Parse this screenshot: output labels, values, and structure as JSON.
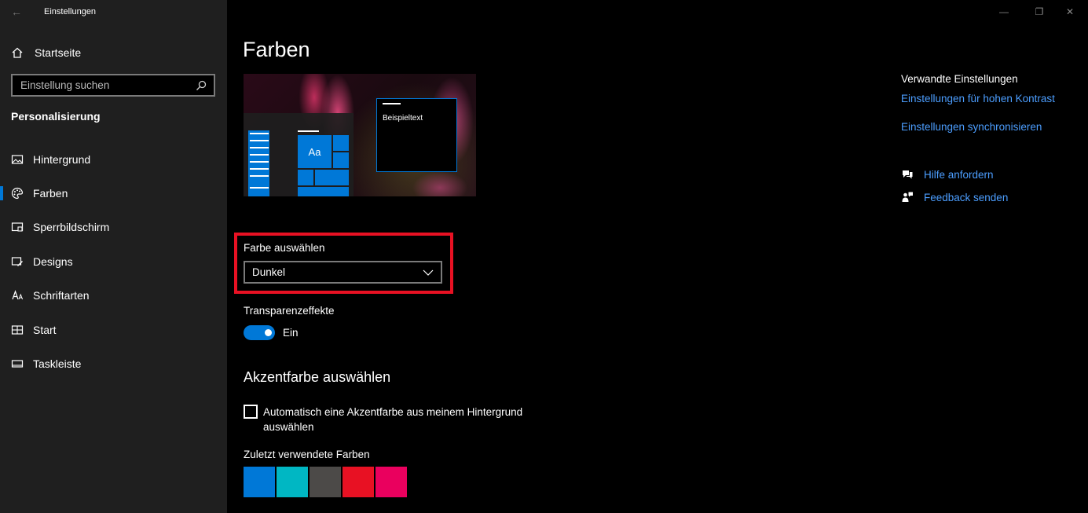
{
  "window": {
    "title": "Einstellungen",
    "controls": {
      "minimize": "—",
      "maximize": "❐",
      "close": "✕"
    }
  },
  "sidebar": {
    "home_label": "Startseite",
    "search_placeholder": "Einstellung suchen",
    "section_title": "Personalisierung",
    "items": [
      {
        "label": "Hintergrund",
        "icon": "image-icon",
        "active": false
      },
      {
        "label": "Farben",
        "icon": "palette-icon",
        "active": true
      },
      {
        "label": "Sperrbildschirm",
        "icon": "lockscreen-icon",
        "active": false
      },
      {
        "label": "Designs",
        "icon": "themes-icon",
        "active": false
      },
      {
        "label": "Schriftarten",
        "icon": "fonts-icon",
        "active": false
      },
      {
        "label": "Start",
        "icon": "start-icon",
        "active": false
      },
      {
        "label": "Taskleiste",
        "icon": "taskbar-icon",
        "active": false
      }
    ]
  },
  "main": {
    "title": "Farben",
    "preview": {
      "tile_label": "Aa",
      "sample_text": "Beispieltext"
    },
    "color_select": {
      "label": "Farbe auswählen",
      "value": "Dunkel"
    },
    "transparency": {
      "label": "Transparenzeffekte",
      "state": "Ein",
      "on": true
    },
    "accent": {
      "title": "Akzentfarbe auswählen",
      "auto_checkbox_label": "Automatisch eine Akzentfarbe aus meinem Hintergrund auswählen",
      "auto_checked": false,
      "recent_label": "Zuletzt verwendete Farben",
      "recent_colors": [
        "#0078d7",
        "#00b7c3",
        "#4c4a48",
        "#e81123",
        "#ea005e"
      ]
    }
  },
  "related": {
    "heading": "Verwandte Einstellungen",
    "links": [
      "Einstellungen für hohen Kontrast",
      "Einstellungen synchronisieren"
    ],
    "help_label": "Hilfe anfordern",
    "feedback_label": "Feedback senden"
  },
  "colors": {
    "accent": "#0078d7",
    "link": "#4c9eff",
    "highlight_border": "#e81123",
    "sidebar_bg": "#1f1f1f"
  }
}
